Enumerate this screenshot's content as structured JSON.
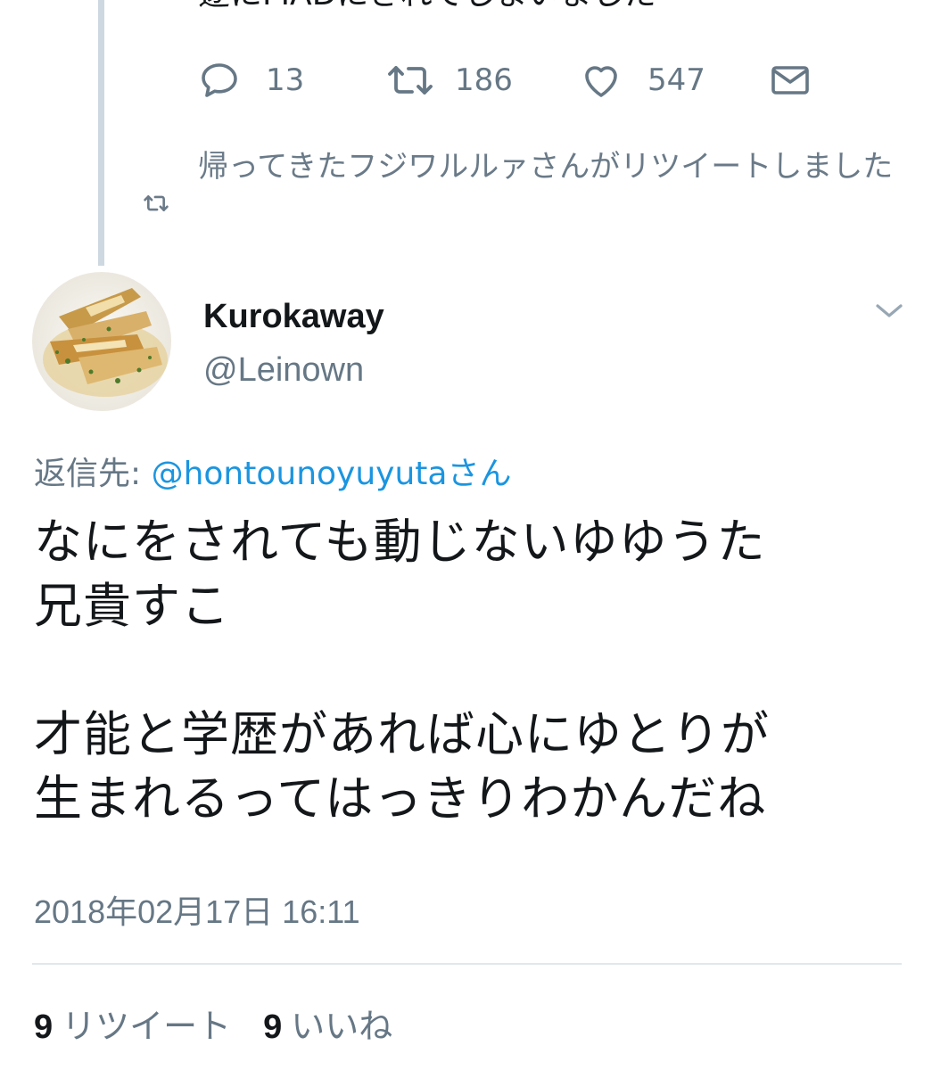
{
  "previous_tweet": {
    "text_fragment": "遂にMADにされてしまいました",
    "actions": {
      "reply_count": "13",
      "retweet_count": "186",
      "like_count": "547"
    }
  },
  "retweet_notice": {
    "text": "帰ってきたフジワルルァさんがリツイートしました"
  },
  "tweet": {
    "display_name": "Kurokaway",
    "handle": "@Leinown",
    "reply_to_label": "返信先:",
    "reply_to_mention": "@hontounoyuyutaさん",
    "body_paragraph_1": "なにをされても動じないゆゆうた\n兄貴すこ",
    "body_paragraph_2": "才能と学歴があれば心にゆとりが\n生まれるってはっきりわかんだね",
    "timestamp": "2018年02月17日 16:11",
    "retweets_count": "9",
    "retweets_label": "リツイート",
    "likes_count": "9",
    "likes_label": "いいね"
  },
  "colors": {
    "text_primary": "#14171a",
    "text_secondary": "#667785",
    "mention_blue": "#1b95e0",
    "thread_line": "#cdd8e0",
    "divider": "#e1e8ed"
  },
  "icons": [
    "reply-icon",
    "retweet-icon",
    "heart-icon",
    "mail-icon",
    "chevron-down-icon"
  ]
}
